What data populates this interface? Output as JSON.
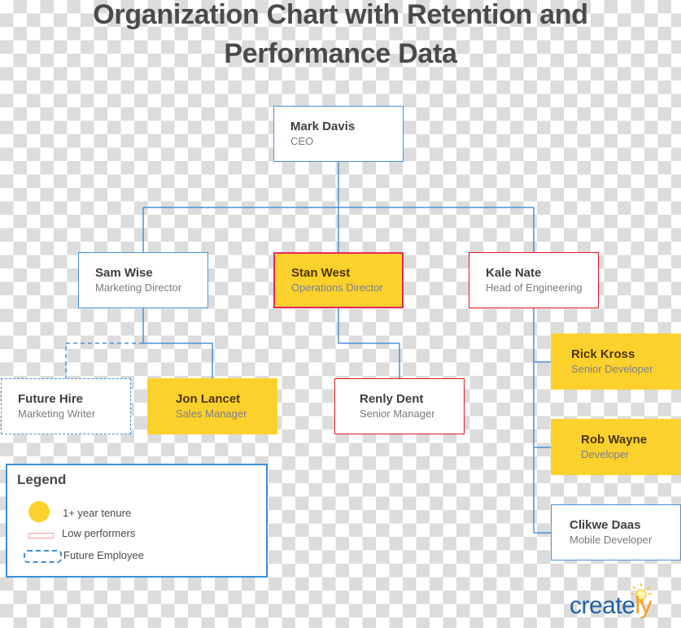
{
  "title": {
    "line1": "Organization Chart with Retention and",
    "line2": "Performance Data"
  },
  "colors": {
    "connector": "#4a90d9",
    "tenure_fill": "#fdd12b",
    "low_performer_border": "#e8141c",
    "future_border": "#4a90d9",
    "brand_blue": "#1f5fa8",
    "brand_orange": "#f6a01a"
  },
  "org": {
    "ceo": {
      "name": "Mark Davis",
      "role": "CEO",
      "tenure_1plus": false,
      "low_performer": false,
      "future": false
    },
    "sam": {
      "name": "Sam Wise",
      "role": "Marketing Director",
      "tenure_1plus": false,
      "low_performer": false,
      "future": false
    },
    "stan": {
      "name": "Stan West",
      "role": "Operations Director",
      "tenure_1plus": true,
      "low_performer": true,
      "future": false
    },
    "kale": {
      "name": "Kale Nate",
      "role": "Head of Engineering",
      "tenure_1plus": false,
      "low_performer": true,
      "future": false
    },
    "future_hire": {
      "name": "Future Hire",
      "role": "Marketing Writer",
      "tenure_1plus": false,
      "low_performer": false,
      "future": true
    },
    "jon": {
      "name": "Jon Lancet",
      "role": "Sales Manager",
      "tenure_1plus": true,
      "low_performer": false,
      "future": false
    },
    "renly": {
      "name": "Renly Dent",
      "role": "Senior Manager",
      "tenure_1plus": false,
      "low_performer": true,
      "future": false
    },
    "rick": {
      "name": "Rick Kross",
      "role": "Senior Developer",
      "tenure_1plus": true,
      "low_performer": false,
      "future": false
    },
    "rob": {
      "name": "Rob Wayne",
      "role": "Developer",
      "tenure_1plus": true,
      "low_performer": false,
      "future": false
    },
    "clikwe": {
      "name": "Clikwe Daas",
      "role": "Mobile Developer",
      "tenure_1plus": false,
      "low_performer": false,
      "future": false
    }
  },
  "reporting_lines": [
    {
      "from": "ceo",
      "to": "sam"
    },
    {
      "from": "ceo",
      "to": "stan"
    },
    {
      "from": "ceo",
      "to": "kale"
    },
    {
      "from": "sam",
      "to": "future_hire",
      "style": "dashed"
    },
    {
      "from": "sam",
      "to": "jon"
    },
    {
      "from": "stan",
      "to": "renly"
    },
    {
      "from": "kale",
      "to": "rick"
    },
    {
      "from": "kale",
      "to": "rob"
    },
    {
      "from": "kale",
      "to": "clikwe"
    }
  ],
  "legend": {
    "title": "Legend",
    "items": [
      {
        "label": "1+ year tenure",
        "icon": "yellow-circle"
      },
      {
        "label": "Low performers",
        "icon": "red-outline-rect"
      },
      {
        "label": "Future Employee",
        "icon": "blue-dashed-rect"
      }
    ]
  },
  "brand": {
    "part1": "create",
    "part2": "ly",
    "icon": "lightbulb-icon"
  }
}
